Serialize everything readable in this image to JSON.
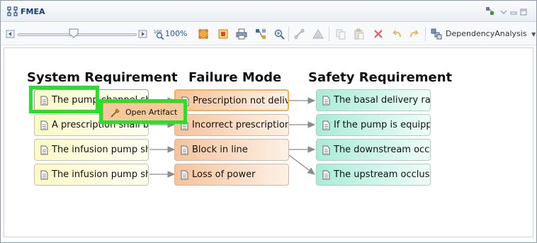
{
  "window": {
    "title": "FMEA",
    "title_icon": "fmea-view-icon",
    "controls": [
      "view-menu-icon",
      "minimize-icon",
      "maximize-icon",
      "close-icon"
    ]
  },
  "toolbar": {
    "zoom_level": "100%",
    "slider_value_percent": 43,
    "icons": [
      "zoom-left-arrow-icon",
      "zoom-right-arrow-icon",
      "zoom-100-icon",
      "fit-page-icon",
      "layout-icon",
      "print-icon",
      "tree-layout-icon",
      "zoom-magnifier-icon",
      "link-icon",
      "triangle-icon",
      "copy-icon",
      "paste-icon",
      "delete-icon",
      "undo-icon",
      "redo-icon",
      "dependency-icon"
    ],
    "analysis_label": "DependencyAnalysis",
    "analysis_dropdown_icon": "chevron-down-icon"
  },
  "diagram": {
    "columns": {
      "system": "System Requirement",
      "failure": "Failure Mode",
      "safety": "Safety Requirement"
    },
    "system_requirements": [
      "The pump channel sh",
      "A prescription shall be",
      "The infusion pump sh",
      "The infusion pump sh"
    ],
    "failure_modes": [
      "Prescription not delivered",
      "Incorrect prescription",
      "Block in line",
      "Loss of power"
    ],
    "safety_requirements": [
      "The basal delivery rate",
      "If the pump is equipped",
      "The downstream occlusion",
      "The upstream occlusion"
    ],
    "context_menu": {
      "item_label": "Open Artifact",
      "item_icon": "open-artifact-icon"
    },
    "colors": {
      "highlight": "#27e02a",
      "system_fill": "#fbf9c6",
      "failure_fill": "#f6c39a",
      "safety_fill": "#a8ecd8",
      "selected_border": "#f4b24b"
    }
  }
}
